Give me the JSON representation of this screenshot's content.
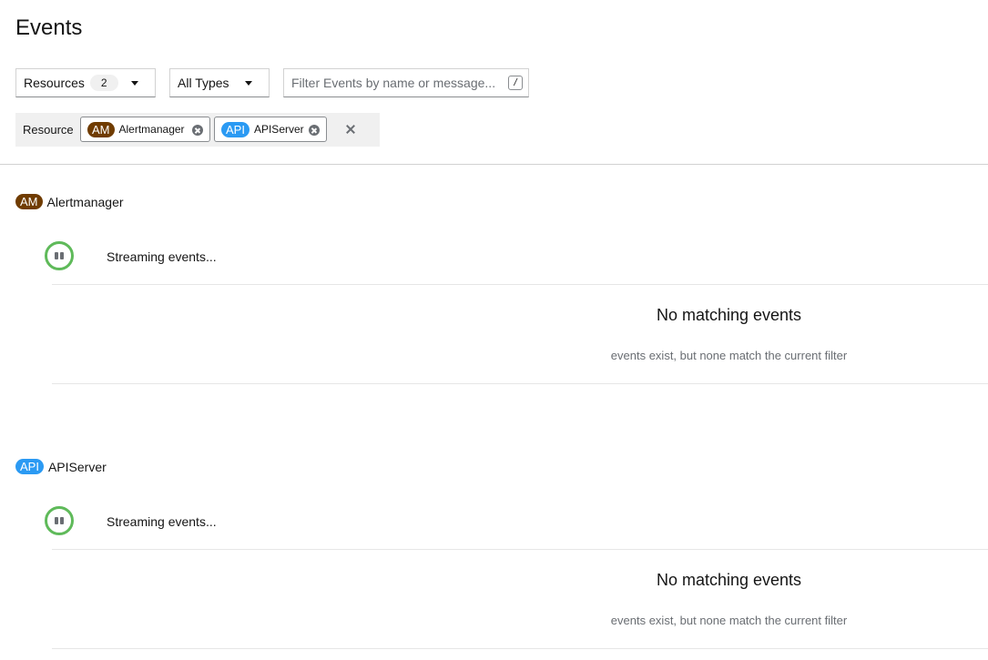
{
  "page": {
    "title": "Events"
  },
  "toolbar": {
    "resources_label": "Resources",
    "resources_count": "2",
    "types_label": "All Types",
    "filter_placeholder": "Filter Events by name or message...",
    "filter_shortcut": "/"
  },
  "chip_group": {
    "label": "Resource",
    "chips": [
      {
        "badge": "AM",
        "label": "Alertmanager"
      },
      {
        "badge": "API",
        "label": "APIServer"
      }
    ]
  },
  "sections": [
    {
      "badge": "AM",
      "name": "Alertmanager",
      "status": "Streaming events...",
      "empty_title": "No matching events",
      "empty_body": "events exist, but none match the current filter"
    },
    {
      "badge": "API",
      "name": "APIServer",
      "status": "Streaming events...",
      "empty_title": "No matching events",
      "empty_body": "events exist, but none match the current filter"
    }
  ],
  "colors": {
    "am_badge": "#703c00",
    "api_badge": "#2b9af3",
    "streaming_ring": "#5fba5a"
  },
  "icons": {
    "dropdown": "caret-down-icon",
    "chip_remove": "remove-circle-icon",
    "clear_all": "close-icon",
    "pause": "pause-icon"
  }
}
